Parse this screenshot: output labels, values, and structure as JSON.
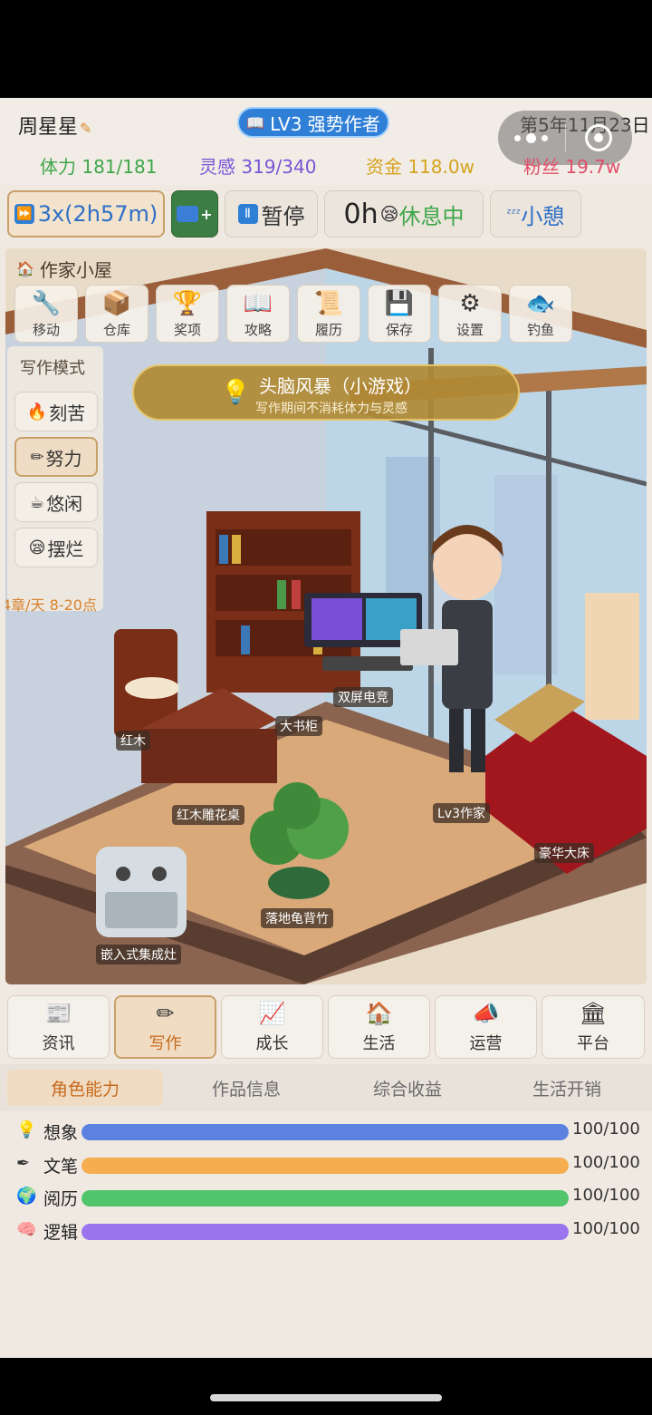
{
  "header": {
    "player_name": "周星星",
    "level_badge": "LV3 强势作者",
    "date": "第5年11月23日",
    "stats": {
      "stamina": "体力 181/181",
      "inspiration": "灵感 319/340",
      "money": "资金 118.0w",
      "fans": "粉丝 19.7w"
    }
  },
  "controls": {
    "speed": "3x(2h57m)",
    "pause": "暂停",
    "rest_hours": "0h",
    "rest_status": "休息中",
    "nap": "小憩"
  },
  "scene": {
    "title": "作家小屋",
    "toolbar": [
      {
        "label": "移动",
        "icon": "wrench-icon"
      },
      {
        "label": "仓库",
        "icon": "box-icon"
      },
      {
        "label": "奖项",
        "icon": "trophy-icon"
      },
      {
        "label": "攻略",
        "icon": "book-icon"
      },
      {
        "label": "履历",
        "icon": "scroll-icon"
      },
      {
        "label": "保存",
        "icon": "floppy-icon"
      },
      {
        "label": "设置",
        "icon": "gear-icon"
      },
      {
        "label": "钓鱼",
        "icon": "fish-icon"
      }
    ],
    "writing_mode": {
      "title": "写作模式",
      "modes": [
        "刻苦",
        "努力",
        "悠闲",
        "摆烂"
      ],
      "active": "努力",
      "note": "4章/天 8-20点"
    },
    "brainstorm": {
      "title": "头脑风暴（小游戏）",
      "subtitle": "写作期间不消耗体力与灵感"
    },
    "objects": {
      "chair": "红木",
      "bookshelf": "大书柜",
      "gaming": "双屏电竞",
      "desk": "红木雕花桌",
      "writer": "Lv3作家",
      "bed": "豪华大床",
      "plant": "落地龟背竹",
      "stove": "嵌入式集成灶"
    }
  },
  "nav": {
    "items": [
      "资讯",
      "写作",
      "成长",
      "生活",
      "运营",
      "平台"
    ],
    "active": "写作"
  },
  "subtabs": {
    "items": [
      "角色能力",
      "作品信息",
      "综合收益",
      "生活开销"
    ],
    "active": "角色能力"
  },
  "abilities": [
    {
      "name": "想象",
      "value": "100/100",
      "fraction": 1.0,
      "color": "#5b82e0",
      "icon": "bulb-icon"
    },
    {
      "name": "文笔",
      "value": "100/100",
      "fraction": 1.0,
      "color": "#f6ad4f",
      "icon": "pen-icon"
    },
    {
      "name": "阅历",
      "value": "100/100",
      "fraction": 1.0,
      "color": "#52c46c",
      "icon": "globe-icon"
    },
    {
      "name": "逻辑",
      "value": "100/100",
      "fraction": 1.0,
      "color": "#9a74ee",
      "icon": "brain-icon"
    }
  ]
}
